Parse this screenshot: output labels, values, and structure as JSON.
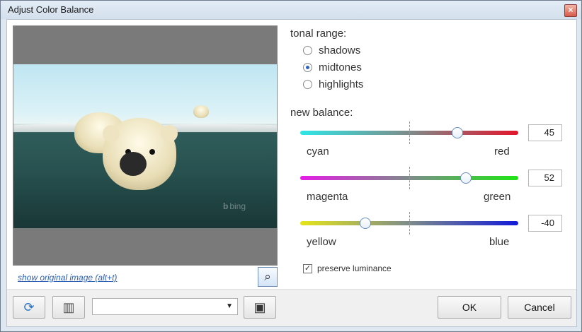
{
  "window": {
    "title": "Adjust Color Balance",
    "close_label": "×"
  },
  "preview": {
    "brand": "bing",
    "brand_icon": "b",
    "show_original": "show original image (alt+t)",
    "zoom_icon": "⌕"
  },
  "tonal_range": {
    "heading": "tonal range:",
    "options": [
      {
        "label": "shadows",
        "selected": false
      },
      {
        "label": "midtones",
        "selected": true
      },
      {
        "label": "highlights",
        "selected": false
      }
    ]
  },
  "balance": {
    "heading": "new balance:",
    "sliders": [
      {
        "left": "cyan",
        "right": "red",
        "value": "45",
        "level": 0.72,
        "color_left": "#2fe6e6",
        "color_right": "#e3152c"
      },
      {
        "left": "magenta",
        "right": "green",
        "value": "52",
        "level": 0.76,
        "color_left": "#e51ce5",
        "color_right": "#1ee614"
      },
      {
        "left": "yellow",
        "right": "blue",
        "value": "-40",
        "level": 0.3,
        "color_left": "#e5e51a",
        "color_right": "#121ad8"
      }
    ]
  },
  "preserve_luminance": {
    "label": "preserve luminance",
    "checked": true
  },
  "footer": {
    "preset_value": "",
    "ok": "OK",
    "cancel": "Cancel",
    "refresh_icon": "⟳",
    "ruler_icon": "▥",
    "save_icon": "▣"
  }
}
